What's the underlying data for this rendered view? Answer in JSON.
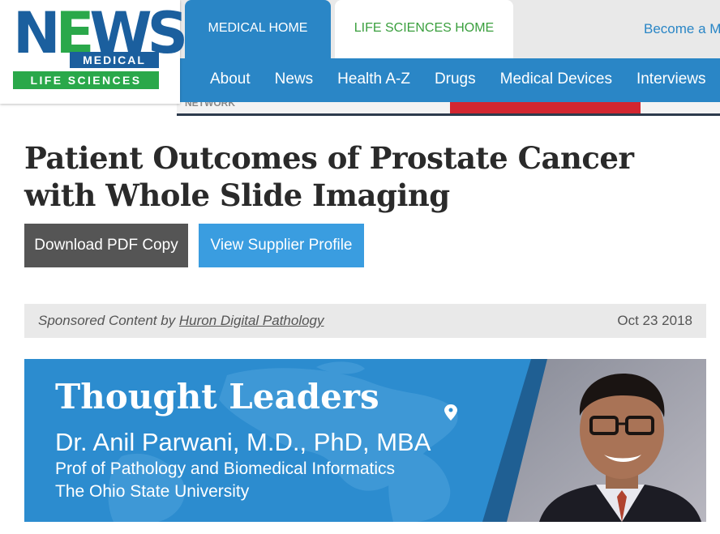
{
  "logo": {
    "news": "NEWS",
    "medical": "MEDICAL",
    "life_sciences": "LIFE SCIENCES"
  },
  "top_tabs": [
    {
      "label": "MEDICAL HOME"
    },
    {
      "label": "LIFE SCIENCES HOME"
    }
  ],
  "become_link": "Become a M",
  "nav_items": [
    {
      "label": "About"
    },
    {
      "label": "News"
    },
    {
      "label": "Health A-Z"
    },
    {
      "label": "Drugs"
    },
    {
      "label": "Medical Devices"
    },
    {
      "label": "Interviews"
    }
  ],
  "banner_partial_text": "NETWORK",
  "article": {
    "title": "Patient Outcomes of Prostate Cancer with Whole Slide Imaging",
    "download_label": "Download PDF Copy",
    "supplier_label": "View Supplier Profile",
    "sponsor_prefix": "Sponsored Content by",
    "sponsor_name": "Huron Digital Pathology",
    "date": "Oct 23 2018"
  },
  "hero": {
    "title": "Thought Leaders",
    "name": "Dr. Anil Parwani, M.D., PhD, MBA",
    "role_line1": "Prof of Pathology and Biomedical Informatics",
    "role_line2": "The Ohio State University"
  },
  "colors": {
    "brand_blue": "#2a86c6",
    "brand_green": "#2aa84a",
    "logo_blue": "#1b5f9e",
    "button_gray": "#555555",
    "button_blue": "#3a9de0",
    "hero_blue": "#2c8ccf"
  },
  "icons": {
    "map_pin": "location-pin-icon"
  }
}
